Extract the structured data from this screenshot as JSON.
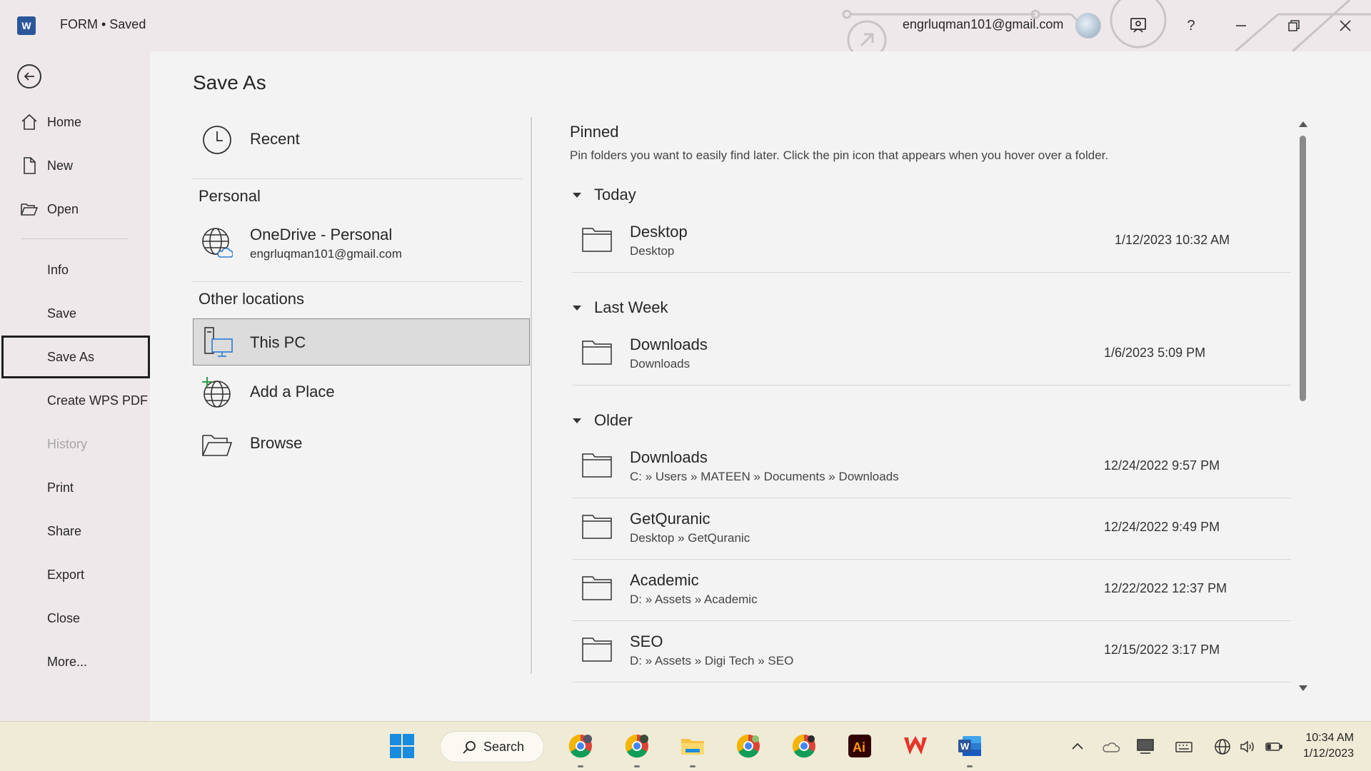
{
  "titlebar": {
    "app_letter": "W",
    "doc_title": "FORM  •  Saved",
    "account": "engrluqman101@gmail.com",
    "help": "?"
  },
  "leftnav": {
    "items": [
      {
        "label": "Home"
      },
      {
        "label": "New"
      },
      {
        "label": "Open"
      },
      {
        "label": "Info"
      },
      {
        "label": "Save"
      },
      {
        "label": "Save As"
      },
      {
        "label": "Create WPS PDF"
      },
      {
        "label": "History"
      },
      {
        "label": "Print"
      },
      {
        "label": "Share"
      },
      {
        "label": "Export"
      },
      {
        "label": "Close"
      },
      {
        "label": "More..."
      }
    ]
  },
  "main": {
    "title": "Save As",
    "locations": {
      "recent": "Recent",
      "personal_header": "Personal",
      "onedrive_name": "OneDrive - Personal",
      "onedrive_email": "engrluqman101@gmail.com",
      "other_header": "Other locations",
      "this_pc": "This PC",
      "add_place": "Add a Place",
      "browse": "Browse"
    },
    "pinned": {
      "title": "Pinned",
      "description": "Pin folders you want to easily find later. Click the pin icon that appears when you hover over a folder."
    },
    "groups": [
      {
        "title": "Today",
        "folders": [
          {
            "name": "Desktop",
            "path": "Desktop",
            "date": "1/12/2023 10:32 AM"
          }
        ]
      },
      {
        "title": "Last Week",
        "folders": [
          {
            "name": "Downloads",
            "path": "Downloads",
            "date": "1/6/2023 5:09 PM"
          }
        ]
      },
      {
        "title": "Older",
        "folders": [
          {
            "name": "Downloads",
            "path": "C: » Users » MATEEN » Documents » Downloads",
            "date": "12/24/2022 9:57 PM"
          },
          {
            "name": "GetQuranic",
            "path": "Desktop » GetQuranic",
            "date": "12/24/2022 9:49 PM"
          },
          {
            "name": "Academic",
            "path": "D: » Assets » Academic",
            "date": "12/22/2022 12:37 PM"
          },
          {
            "name": "SEO",
            "path": "D: » Assets » Digi Tech » SEO",
            "date": "12/15/2022 3:17 PM"
          }
        ]
      }
    ]
  },
  "taskbar": {
    "search_label": "Search",
    "time": "10:34 AM",
    "date": "1/12/2023"
  },
  "colors": {
    "title_bg": "#efe8ea",
    "panel_bg": "#f3f3f3",
    "selected_bg": "#dcdcdc",
    "word_blue": "#2b579a",
    "taskbar_bg": "#f0ebd6"
  }
}
